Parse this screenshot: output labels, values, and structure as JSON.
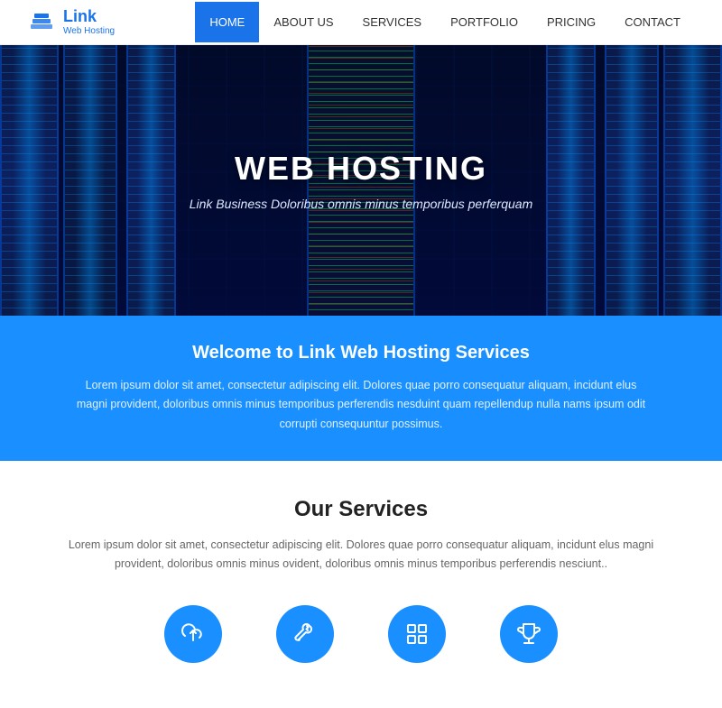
{
  "brand": {
    "name": "Link",
    "tagline": "Web Hosting"
  },
  "nav": {
    "items": [
      {
        "label": "HOME",
        "active": true
      },
      {
        "label": "ABOUT US",
        "active": false
      },
      {
        "label": "SERVICES",
        "active": false
      },
      {
        "label": "PORTFOLIO",
        "active": false
      },
      {
        "label": "PRICING",
        "active": false
      },
      {
        "label": "CONTACT",
        "active": false
      }
    ]
  },
  "hero": {
    "title": "WEB HOSTING",
    "subtitle": "Link Business Doloribus omnis minus temporibus perferquam"
  },
  "banner": {
    "heading": "Welcome to Link Web Hosting Services",
    "body": "Lorem ipsum dolor sit amet, consectetur adipiscing elit. Dolores quae porro consequatur aliquam, incidunt elus magni provident, doloribus omnis minus temporibus perferendis nesduint quam repellendup nulla nams ipsum odit corrupti consequuntur possimus."
  },
  "services": {
    "heading": "Our Services",
    "description": "Lorem ipsum dolor sit amet, consectetur adipiscing elit. Dolores quae porro consequatur aliquam, incidunt elus magni provident, doloribus omnis minus ovident, doloribus omnis minus temporibus perferendis nesciunt..",
    "icons": [
      {
        "name": "cloud-upload",
        "label": "Cloud"
      },
      {
        "name": "tools",
        "label": "Tools"
      },
      {
        "name": "grid",
        "label": "Grid"
      },
      {
        "name": "trophy",
        "label": "Trophy"
      }
    ]
  }
}
